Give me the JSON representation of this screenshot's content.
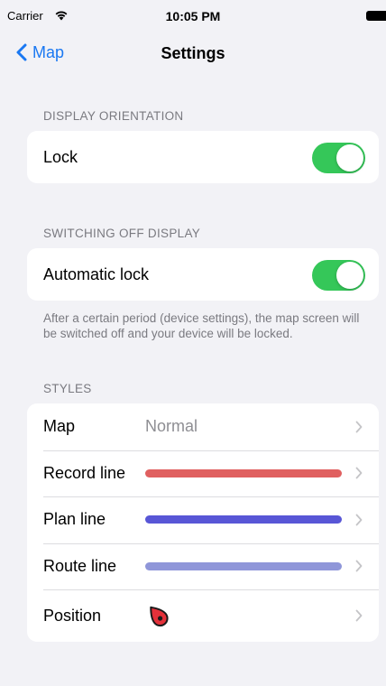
{
  "status_bar": {
    "carrier": "Carrier",
    "time": "10:05 PM",
    "wifi_icon": "wifi-icon",
    "battery_icon": "battery-icon"
  },
  "nav": {
    "back_label": "Map",
    "title": "Settings"
  },
  "sections": {
    "display_orientation": {
      "header": "DISPLAY ORIENTATION",
      "lock_label": "Lock",
      "lock_on": true
    },
    "switching_off": {
      "header": "SWITCHING OFF DISPLAY",
      "auto_lock_label": "Automatic lock",
      "auto_lock_on": true,
      "footer": "After a certain period (device settings), the map screen will be switched off and your device will be locked."
    },
    "styles": {
      "header": "STYLES",
      "items": [
        {
          "label": "Map",
          "value": "Normal"
        },
        {
          "label": "Record line",
          "color": "#e06060"
        },
        {
          "label": "Plan line",
          "color": "#5856d6"
        },
        {
          "label": "Route line",
          "color": "#8f96d9"
        },
        {
          "label": "Position",
          "icon": "location-arrow-icon",
          "color": "#e4313a"
        }
      ]
    }
  },
  "colors": {
    "accent": "#1a78f2",
    "toggle_on": "#35c759",
    "background": "#f2f2f6"
  }
}
